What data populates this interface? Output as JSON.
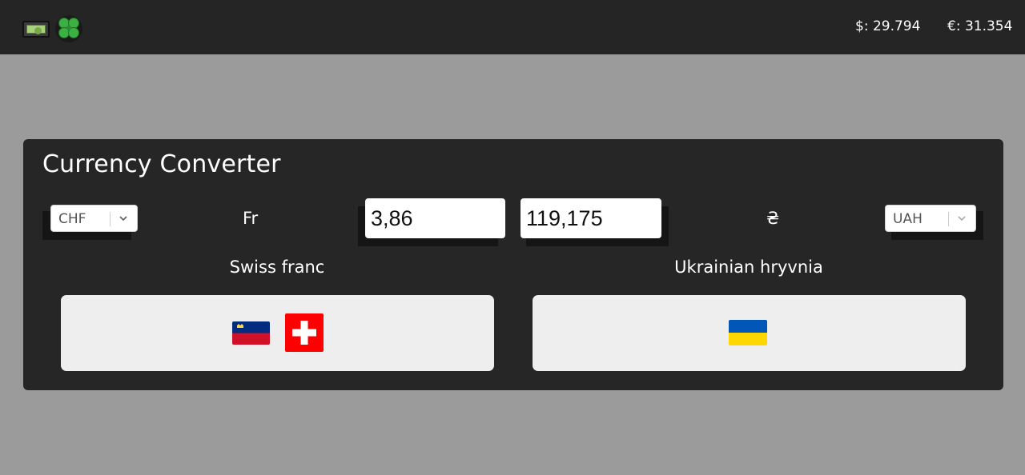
{
  "header": {
    "logo_icons": [
      "money-bill-icon",
      "four-leaf-clover-icon"
    ],
    "rates": {
      "usd": "$: 29.794",
      "eur": "€: 31.354"
    }
  },
  "converter": {
    "title": "Currency Converter",
    "from": {
      "code": "CHF",
      "symbol": "Fr",
      "amount": "3,86",
      "name": "Swiss franc",
      "flags": [
        "liechtenstein-flag-icon",
        "switzerland-flag-icon"
      ]
    },
    "to": {
      "code": "UAH",
      "symbol": "₴",
      "amount": "119,175",
      "name": "Ukrainian hryvnia",
      "flags": [
        "ukraine-flag-icon"
      ]
    }
  },
  "colors": {
    "topbar": "#252525",
    "page_background": "#9b9b9b",
    "panel": "#262626",
    "card": "#eeeeee",
    "swiss_red": "#ff0000",
    "liechtenstein_blue": "#002b7f",
    "liechtenstein_red": "#ce1126",
    "ukraine_blue": "#0057b7",
    "ukraine_yellow": "#ffd700"
  }
}
